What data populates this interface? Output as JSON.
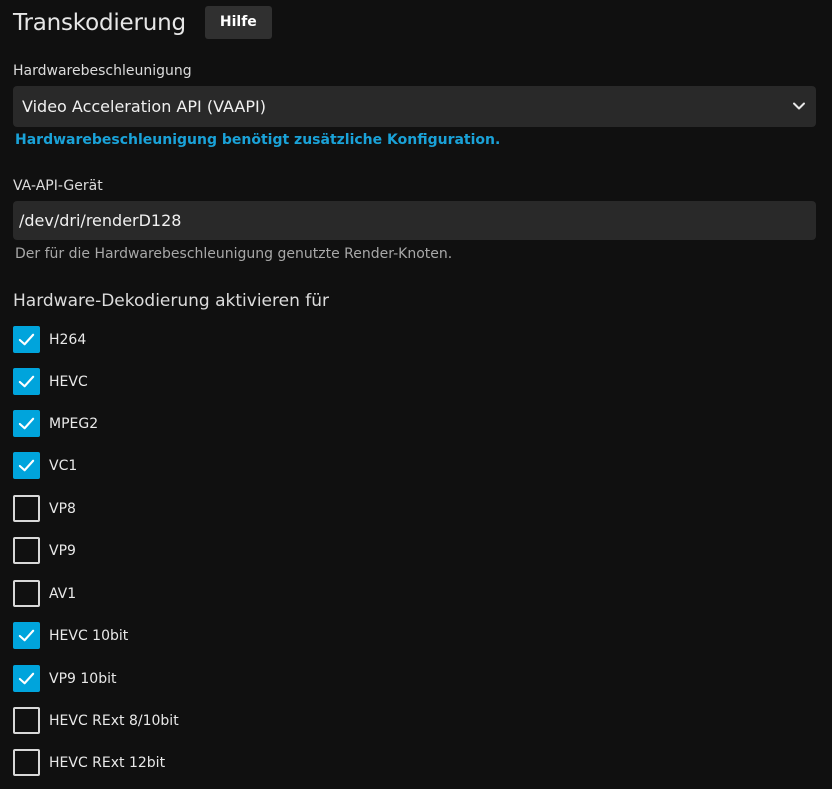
{
  "header": {
    "title": "Transkodierung",
    "help_button": "Hilfe"
  },
  "hardware_acceleration": {
    "label": "Hardwarebeschleunigung",
    "selected": "Video Acceleration API (VAAPI)",
    "config_link": "Hardwarebeschleunigung benötigt zusätzliche Konfiguration."
  },
  "vaapi_device": {
    "label": "VA-API-Gerät",
    "value": "/dev/dri/renderD128",
    "help": "Der für die Hardwarebeschleunigung genutzte Render-Knoten."
  },
  "decoding": {
    "title": "Hardware-Dekodierung aktivieren für",
    "codecs": [
      {
        "label": "H264",
        "checked": true
      },
      {
        "label": "HEVC",
        "checked": true
      },
      {
        "label": "MPEG2",
        "checked": true
      },
      {
        "label": "VC1",
        "checked": true
      },
      {
        "label": "VP8",
        "checked": false
      },
      {
        "label": "VP9",
        "checked": false
      },
      {
        "label": "AV1",
        "checked": false
      },
      {
        "label": "HEVC 10bit",
        "checked": true
      },
      {
        "label": "VP9 10bit",
        "checked": true
      },
      {
        "label": "HEVC RExt 8/10bit",
        "checked": false
      },
      {
        "label": "HEVC RExt 12bit",
        "checked": false
      }
    ]
  },
  "colors": {
    "accent": "#00a4dc",
    "link": "#1aa2d8",
    "background": "#101010",
    "field_background": "#292929"
  }
}
